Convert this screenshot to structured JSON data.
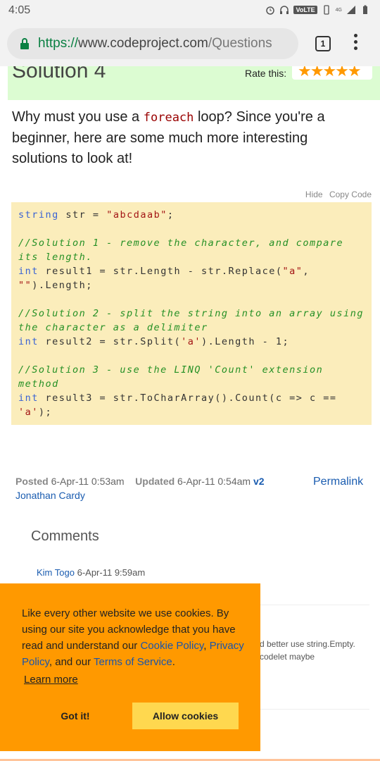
{
  "statusbar": {
    "time": "4:05",
    "volte": "VoLTE",
    "network": "4G"
  },
  "browser": {
    "url_proto": "https://",
    "url_host": "www.codeproject.com",
    "url_path": "/Questions",
    "tab_count": "1"
  },
  "solution": {
    "title": "Solution 4",
    "rate_label": "Rate this:",
    "stars": "★★★★★"
  },
  "intro": {
    "before": "Why must you use a ",
    "code": "foreach",
    "after": " loop? Since you're a beginner, here are some much more interesting solutions to look at!"
  },
  "code_links": {
    "hide": "Hide",
    "copy": "Copy Code"
  },
  "post": {
    "posted_label": "Posted",
    "posted_date": "6-Apr-11 0:53am",
    "updated_label": "Updated",
    "updated_date": "6-Apr-11 0:54am",
    "version": "v2",
    "author": "Jonathan Cardy",
    "permalink": "Permalink"
  },
  "comments": {
    "title": "Comments",
    "author": "Kim Togo",
    "date": "6-Apr-11 9:59am",
    "text_line1": "d better use string.Empty.",
    "text_line2": "codelet maybe"
  },
  "cookie": {
    "text1": "Like every other website we use cookies. By using our site you acknowledge that you have read and understand our ",
    "link1": "Cookie Policy",
    "text2": ", ",
    "link2": "Privacy Policy",
    "text3": ", and our ",
    "link3": "Terms of Service",
    "text4": ".",
    "learn_more": "Learn more",
    "got_it": "Got it!",
    "allow": "Allow cookies"
  },
  "colors": {
    "accent_link": "#1a5cb0",
    "cookie_bg": "#ff9900",
    "allow_bg": "#ffd84f",
    "solution_bg": "#dcfcd2",
    "code_bg": "#fbedbb"
  }
}
